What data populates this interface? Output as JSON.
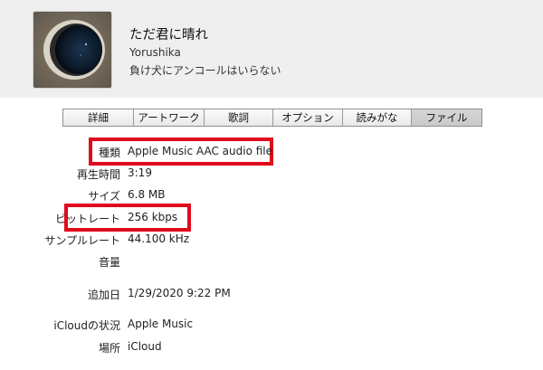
{
  "track": {
    "title": "ただ君に晴れ",
    "artist": "Yorushika",
    "album": "負け犬にアンコールはいらない"
  },
  "tabs": [
    "詳細",
    "アートワーク",
    "歌詞",
    "オプション",
    "読みがな",
    "ファイル"
  ],
  "active_tab": "ファイル",
  "fields": {
    "kind_label": "種類",
    "kind_value": "Apple Music AAC audio file",
    "duration_label": "再生時間",
    "duration_value": "3:19",
    "size_label": "サイズ",
    "size_value": "6.8 MB",
    "bitrate_label": "ビットレート",
    "bitrate_value": "256 kbps",
    "samplerate_label": "サンプルレート",
    "samplerate_value": "44.100 kHz",
    "volume_label": "音量",
    "volume_value": "",
    "date_added_label": "追加日",
    "date_added_value": "1/29/2020 9:22 PM",
    "icloud_label": "iCloudの状況",
    "icloud_value": "Apple Music",
    "location_label": "場所",
    "location_value": "iCloud"
  },
  "colors": {
    "highlight": "#e1091c",
    "header_bg": "#efefef",
    "active_tab_bg": "#cfcfcf"
  },
  "icons": {
    "artwork": "album-artwork-eye"
  }
}
